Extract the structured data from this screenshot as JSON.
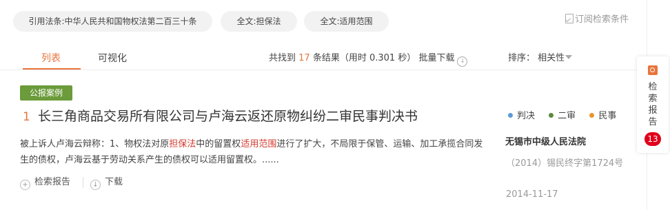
{
  "filters": {
    "chips": [
      "引用法条:中华人民共和国物权法第二百三十条",
      "全文:担保法",
      "全文:适用范围"
    ],
    "subscribe_label": "订阅检索条件"
  },
  "tabs": [
    "列表",
    "可视化"
  ],
  "summary": {
    "prefix": "共找到",
    "count": "17",
    "suffix": "条结果（用时 0.301 秒）",
    "batch_download": "批量下载"
  },
  "sort": {
    "label": "排序：",
    "value": "相关性"
  },
  "result": {
    "badge": "公报案例",
    "index": "1",
    "title": "长三角商品交易所有限公司与卢海云返还原物纠纷二审民事判决书",
    "snippet": {
      "part1": "被上诉人卢海云辩称：1、物权法对原",
      "hl1": "担保法",
      "part2": "中的留置权",
      "hl2": "适用范围",
      "part3": "进行了扩大，不局限于保管、运输、加工承揽合同发生的债权，卢海云基于劳动关系产生的债权可以适用留置权。......"
    },
    "actions": [
      "检索报告",
      "下载"
    ],
    "legend": [
      {
        "label": "判决",
        "color": "#5b9bd5"
      },
      {
        "label": "二审",
        "color": "#5a8a3a"
      },
      {
        "label": "民事",
        "color": "#e8952c"
      }
    ],
    "court": "无锡市中级人民法院",
    "case_number": "（2014）锡民终字第1724号",
    "date": "2014-11-17"
  },
  "side_panel": {
    "label": "检索报告",
    "count": "13"
  },
  "colors": {
    "accent": "#e8743c",
    "badge": "#6b9b3a",
    "highlight": "#d23b2e",
    "count_badge": "#e0001b"
  }
}
